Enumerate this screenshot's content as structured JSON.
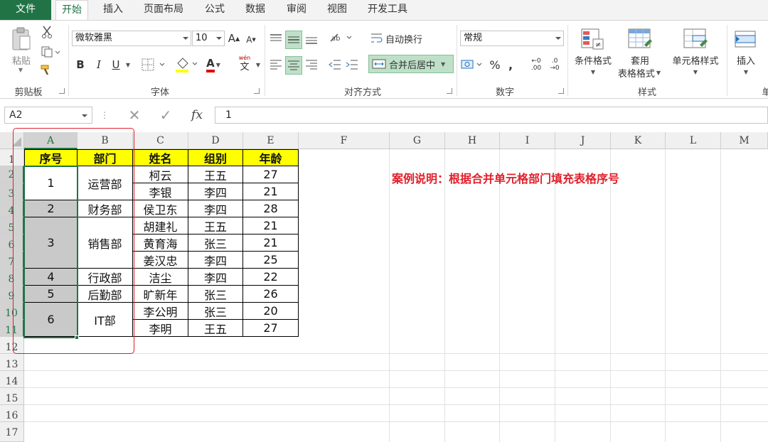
{
  "tabs": [
    "文件",
    "开始",
    "插入",
    "页面布局",
    "公式",
    "数据",
    "审阅",
    "视图",
    "开发工具"
  ],
  "ribbon": {
    "clipboard": {
      "paste_label": "粘贴",
      "group_label": "剪贴板"
    },
    "font": {
      "font_name": "微软雅黑",
      "font_size": "10",
      "group_label": "字体",
      "bold": "B",
      "italic": "I",
      "underline": "U",
      "grow": "A",
      "shrink": "A",
      "font_color_letter": "A",
      "pinyin_top": "wén",
      "pinyin_char": "文"
    },
    "align": {
      "wrap_label": "自动换行",
      "merge_label": "合并后居中",
      "group_label": "对齐方式"
    },
    "number": {
      "format": "常规",
      "percent": "%",
      "group_label": "数字",
      "inc_decimal": ".00",
      "dec_decimal": ".0"
    },
    "styles": {
      "cond_format": "条件格式",
      "table_format_1": "套用",
      "table_format_2": "表格格式",
      "cell_styles": "单元格样式",
      "group_label": "样式"
    },
    "cells": {
      "insert_label": "插入",
      "group_label_partial": "单"
    }
  },
  "formula_bar": {
    "name_box": "A2",
    "cancel_icon": "✕",
    "enter_icon": "✓",
    "fx": "fx",
    "content": "1"
  },
  "columns": [
    "A",
    "B",
    "C",
    "D",
    "E",
    "F",
    "G",
    "H",
    "I",
    "J",
    "K",
    "L",
    "M"
  ],
  "rows": [
    "1",
    "2",
    "3",
    "4",
    "5",
    "6",
    "7",
    "8",
    "9",
    "10",
    "11",
    "12",
    "13",
    "14",
    "15",
    "16",
    "17"
  ],
  "table": {
    "headers": [
      "序号",
      "部门",
      "姓名",
      "组别",
      "年龄"
    ],
    "seq": [
      "1",
      "2",
      "3",
      "4",
      "5",
      "6"
    ],
    "depts": [
      "运营部",
      "财务部",
      "销售部",
      "行政部",
      "后勤部",
      "IT部"
    ],
    "names": [
      "柯云",
      "李银",
      "侯卫东",
      "胡建礼",
      "黄育海",
      "姜汉忠",
      "洁尘",
      "旷新年",
      "李公明",
      "李明"
    ],
    "groups": [
      "王五",
      "李四",
      "李四",
      "王五",
      "张三",
      "李四",
      "李四",
      "张三",
      "张三",
      "王五"
    ],
    "ages": [
      "27",
      "21",
      "28",
      "21",
      "21",
      "25",
      "22",
      "26",
      "20",
      "27"
    ]
  },
  "note": "案例说明：根据合并单元格部门填充表格序号",
  "colors": {
    "excel_green": "#217346",
    "header_yellow": "#ffff00",
    "merged_gray": "#c9c9c9",
    "note_red": "#e0202a"
  }
}
